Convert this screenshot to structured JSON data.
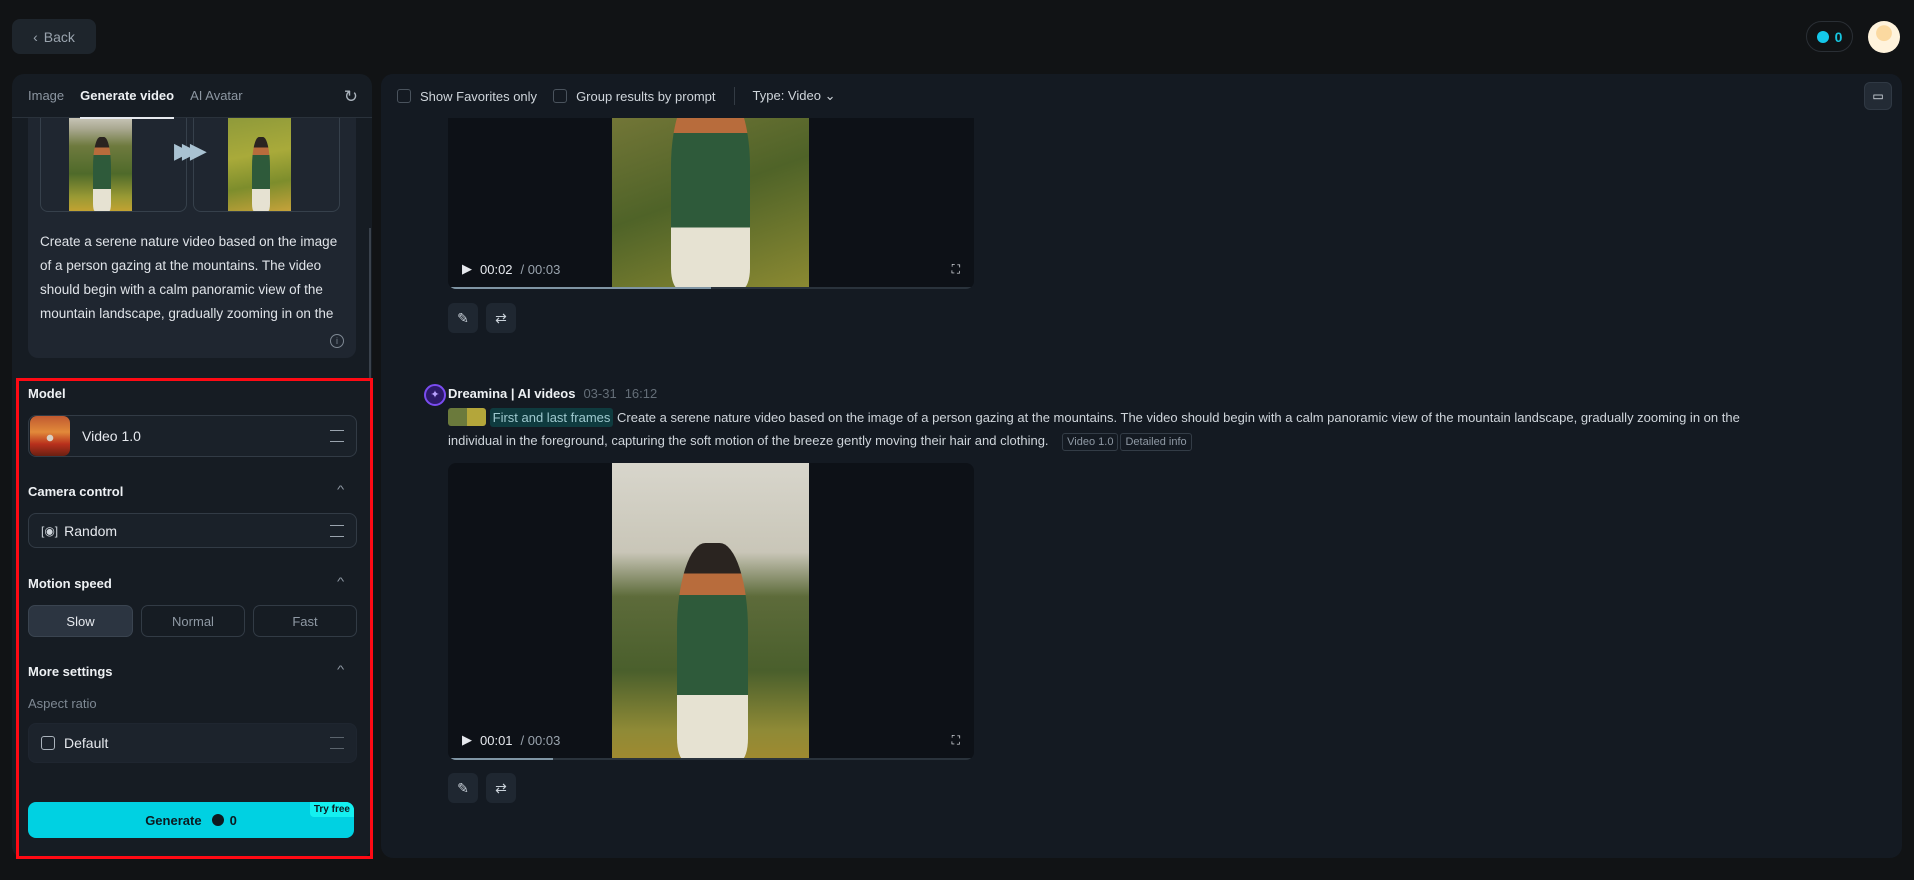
{
  "header": {
    "back_label": "Back",
    "credits": "0"
  },
  "left_panel": {
    "tabs": [
      {
        "label": "Image"
      },
      {
        "label": "Generate video"
      },
      {
        "label": "AI Avatar"
      }
    ],
    "prompt": "Create a serene nature video based on the image of a person gazing at the mountains. The video should begin with a calm panoramic view of the mountain landscape, gradually zooming in on the individual in the foreground, capturing the soft motion of the breeze gently moving their hair and clothing.",
    "model_label": "Model",
    "model_value": "Video 1.0",
    "camera_label": "Camera control",
    "camera_value": "Random",
    "motion_label": "Motion speed",
    "motion_options": [
      "Slow",
      "Normal",
      "Fast"
    ],
    "motion_selected": "Slow",
    "more_label": "More settings",
    "aspect_label": "Aspect ratio",
    "aspect_value": "Default",
    "generate_label": "Generate",
    "generate_cost": "0",
    "try_free": "Try free"
  },
  "toolbar": {
    "favorites": "Show Favorites only",
    "group": "Group results by prompt",
    "type": "Type: Video"
  },
  "results": [
    {
      "current": "00:02",
      "sep": "/",
      "total": "00:03",
      "progress": 0.5
    },
    {
      "author": "Dreamina | AI videos",
      "date": "03-31",
      "time": "16:12",
      "frames_tag": "First and last frames",
      "prompt": "Create a serene nature video based on the image of a person gazing at the mountains. The video should begin with a calm panoramic view of the mountain landscape, gradually zooming in on the individual in the foreground, capturing the soft motion of the breeze gently moving their hair and clothing.",
      "model_tag": "Video 1.0",
      "info_tag": "Detailed info",
      "current": "00:01",
      "sep": "/",
      "total": "00:03",
      "progress": 0.2
    }
  ],
  "colors": {
    "accent": "#00d1e2",
    "highlight": "#ff0a14"
  }
}
